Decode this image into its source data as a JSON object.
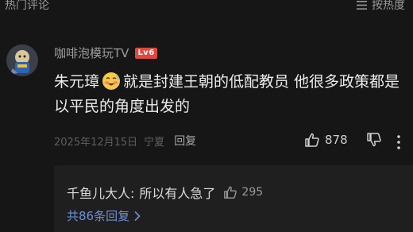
{
  "header": {
    "title": "热门评论",
    "sort_label": "按热度"
  },
  "comment": {
    "username": "咖啡泡模玩TV",
    "level_badge": "Lv6",
    "text_before_emoji": "朱元璋",
    "text_after_emoji": "就是封建王朝的低配教员 他很多政策都是以平民的角度出发的",
    "date": "2025年12月15日",
    "location": "宁夏",
    "reply_label": "回复",
    "like_count": "878"
  },
  "top_reply": {
    "author": "千鱼儿大人:",
    "text": "所以有人急了",
    "like_count": "295"
  },
  "see_replies_label": "共86条回复",
  "colors": {
    "background": "#161616",
    "reply_box": "#1f1f1f",
    "link": "#6f8fd6",
    "level_badge": "#e0473c"
  }
}
